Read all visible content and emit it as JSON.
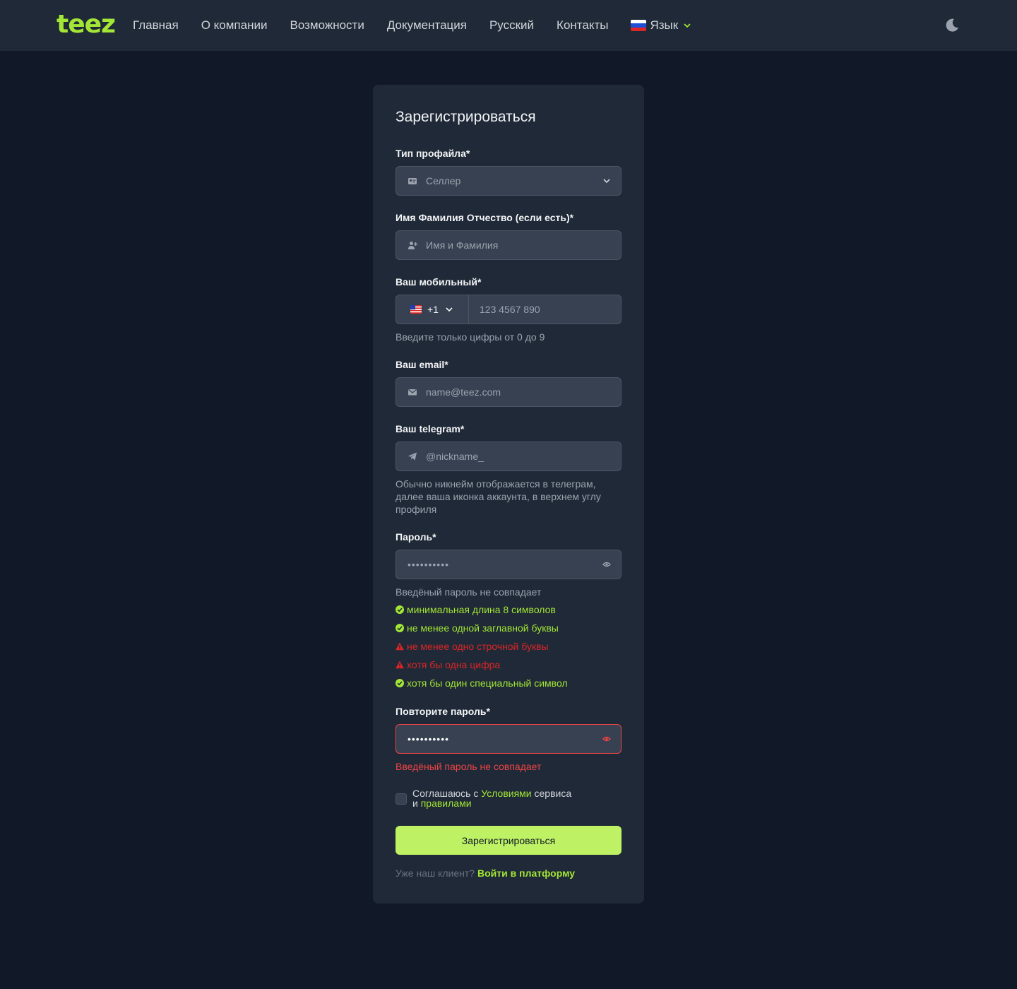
{
  "header": {
    "logo": "teez",
    "nav": [
      "Главная",
      "О компании",
      "Возможности",
      "Документация",
      "Русский",
      "Контакты"
    ],
    "language_label": "Язык"
  },
  "form": {
    "title": "Зарегистрироваться",
    "profile_type": {
      "label": "Тип профайла*",
      "value": "Селлер"
    },
    "full_name": {
      "label": "Имя Фамилия Отчество (если есть)*",
      "placeholder": "Имя и Фамилия"
    },
    "phone": {
      "label": "Ваш мобильный*",
      "country_code": "+1",
      "placeholder": "123 4567 890",
      "help": "Введите только цифры от 0 до 9"
    },
    "email": {
      "label": "Ваш email*",
      "placeholder": "name@teez.com"
    },
    "telegram": {
      "label": "Ваш  telegram*",
      "placeholder": "@nickname_",
      "help": "Обычно никнейм отображается в телеграм, далее ваша иконка аккаунта, в верхнем углу профиля"
    },
    "password": {
      "label": "Пароль*",
      "value_mask": "••••••••••",
      "mismatch_note": "Введёный пароль не совпадает",
      "rules": [
        {
          "text": "минимальная длина 8 символов",
          "status": "ok"
        },
        {
          "text": "не менее одной заглавной буквы",
          "status": "ok"
        },
        {
          "text": "не менее одно строчной буквы",
          "status": "bad"
        },
        {
          "text": "хотя бы одна цифра",
          "status": "bad"
        },
        {
          "text": "хотя бы один специальный символ",
          "status": "ok"
        }
      ]
    },
    "confirm_password": {
      "label": "Повторите пароль*",
      "value_mask": "••••••••••",
      "error": "Введёный пароль не совпадает"
    },
    "agreement": {
      "prefix": "Соглашаюсь с ",
      "terms_link": "Условиями",
      "middle": " сервиса",
      "line2_prefix": "и ",
      "rules_link": "правилами"
    },
    "submit_label": "Зарегистрироваться",
    "login_prompt": "Уже наш клиент? ",
    "login_link": "Войти в платформу"
  },
  "colors": {
    "accent": "#a3e635",
    "button": "#bef264",
    "error": "#ef4444",
    "background": "#111827",
    "surface": "#1f2937"
  }
}
